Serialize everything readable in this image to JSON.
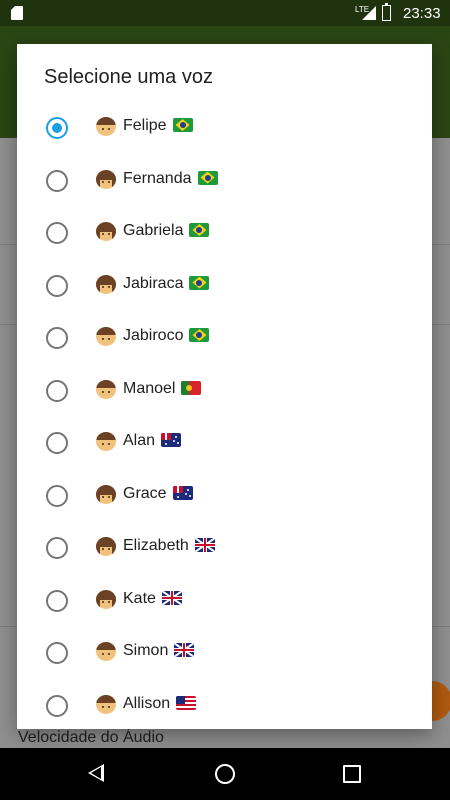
{
  "status_bar": {
    "time": "23:33",
    "network": "LTE",
    "icons": [
      "sd-card-icon",
      "signal-icon",
      "battery-icon"
    ]
  },
  "background": {
    "label": "Velocidade do Áudio"
  },
  "dialog": {
    "title": "Selecione uma voz",
    "options": [
      {
        "name": "Felipe",
        "gender": "male",
        "flag": "br",
        "selected": true
      },
      {
        "name": "Fernanda",
        "gender": "female",
        "flag": "br",
        "selected": false
      },
      {
        "name": "Gabriela",
        "gender": "female",
        "flag": "br",
        "selected": false
      },
      {
        "name": "Jabiraca",
        "gender": "female",
        "flag": "br",
        "selected": false
      },
      {
        "name": "Jabiroco",
        "gender": "male",
        "flag": "br",
        "selected": false
      },
      {
        "name": "Manoel",
        "gender": "male",
        "flag": "pt",
        "selected": false
      },
      {
        "name": "Alan",
        "gender": "male",
        "flag": "au",
        "selected": false
      },
      {
        "name": "Grace",
        "gender": "female",
        "flag": "au",
        "selected": false
      },
      {
        "name": "Elizabeth",
        "gender": "female",
        "flag": "gb",
        "selected": false
      },
      {
        "name": "Kate",
        "gender": "female",
        "flag": "gb",
        "selected": false
      },
      {
        "name": "Simon",
        "gender": "male",
        "flag": "gb",
        "selected": false
      },
      {
        "name": "Allison",
        "gender": "male",
        "flag": "us",
        "selected": false
      }
    ]
  },
  "nav_bar": {
    "icons": [
      "back-icon",
      "home-icon",
      "recent-apps-icon"
    ]
  },
  "colors": {
    "accent": "#1a9fe3",
    "app_bar": "#2b4513",
    "status_bar": "#20330f",
    "fab": "#b05a10"
  }
}
